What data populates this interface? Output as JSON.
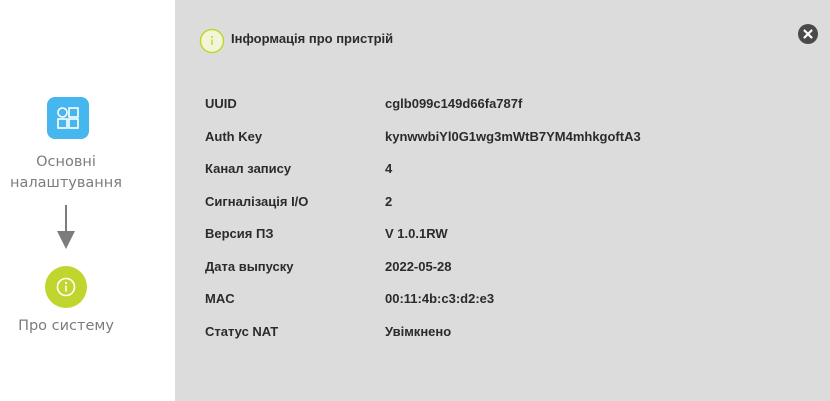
{
  "flow": {
    "settings_label": "Основні налаштування",
    "about_label": "Про систему",
    "settings_icon": "grid-shapes-icon",
    "about_icon": "info-icon",
    "accent_settings": "#45b6ee",
    "accent_about": "#c2d52e"
  },
  "panel": {
    "title": "Інформація про пристрій",
    "header_icon": "info-icon",
    "close_icon": "close-icon",
    "rows": [
      {
        "label": "UUID",
        "value": "cglb099c149d66fa787f"
      },
      {
        "label": "Auth Key",
        "value": "kynwwbiYl0G1wg3mWtB7YM4mhkgoftA3"
      },
      {
        "label": "Канал запису",
        "value": "4"
      },
      {
        "label": "Сигналізація І/О",
        "value": "2"
      },
      {
        "label": "Версия ПЗ",
        "value": "V 1.0.1RW"
      },
      {
        "label": "Дата выпуску",
        "value": "2022-05-28"
      },
      {
        "label": "MAC",
        "value": "00:11:4b:c3:d2:e3"
      },
      {
        "label": "Статус NAT",
        "value": "Увімкнено"
      }
    ]
  }
}
